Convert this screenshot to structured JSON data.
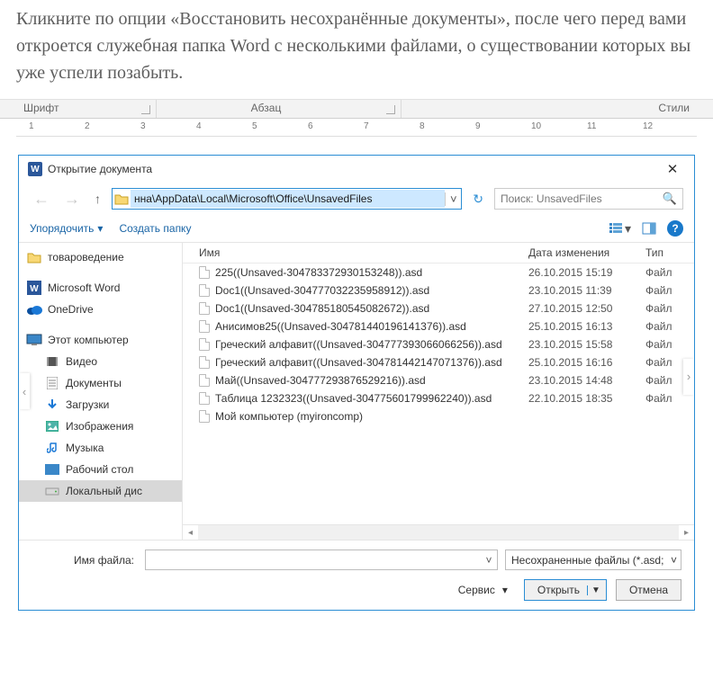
{
  "article": "Кликните по опции «Восстановить несохранённые документы», после чего перед вами откроется служебная папка Word с несколькими файлами, о существовании которых вы уже успели позабыть.",
  "ribbon": {
    "font": "Шрифт",
    "para": "Абзац",
    "styles": "Стили"
  },
  "ruler_ticks": [
    "1",
    "2",
    "3",
    "4",
    "5",
    "6",
    "7",
    "8",
    "9",
    "10",
    "11",
    "12"
  ],
  "dialog": {
    "title": "Открытие документа",
    "path": "нна\\AppData\\Local\\Microsoft\\Office\\UnsavedFiles",
    "search_placeholder": "Поиск: UnsavedFiles",
    "toolbar": {
      "organize": "Упорядочить",
      "newfolder": "Создать папку"
    },
    "columns": {
      "name": "Имя",
      "date": "Дата изменения",
      "type": "Тип"
    },
    "nav": [
      {
        "label": "товароведение",
        "icon": "folder"
      },
      {
        "label": "Microsoft Word",
        "icon": "word"
      },
      {
        "label": "OneDrive",
        "icon": "onedrive"
      },
      {
        "label": "Этот компьютер",
        "icon": "pc"
      },
      {
        "label": "Видео",
        "icon": "video",
        "indent": true
      },
      {
        "label": "Документы",
        "icon": "docs",
        "indent": true
      },
      {
        "label": "Загрузки",
        "icon": "down",
        "indent": true
      },
      {
        "label": "Изображения",
        "icon": "pic",
        "indent": true
      },
      {
        "label": "Музыка",
        "icon": "music",
        "indent": true
      },
      {
        "label": "Рабочий стол",
        "icon": "desk",
        "indent": true
      },
      {
        "label": "Локальный дис",
        "icon": "disk",
        "indent": true,
        "sel": true
      }
    ],
    "files": [
      {
        "name": "225((Unsaved-304783372930153248)).asd",
        "date": "26.10.2015 15:19",
        "type": "Файл"
      },
      {
        "name": "Doc1((Unsaved-304777032235958912)).asd",
        "date": "23.10.2015 11:39",
        "type": "Файл"
      },
      {
        "name": "Doc1((Unsaved-304785180545082672)).asd",
        "date": "27.10.2015 12:50",
        "type": "Файл"
      },
      {
        "name": "Анисимов25((Unsaved-304781440196141376)).asd",
        "date": "25.10.2015 16:13",
        "type": "Файл"
      },
      {
        "name": "Греческий алфавит((Unsaved-304777393066066256)).asd",
        "date": "23.10.2015 15:58",
        "type": "Файл"
      },
      {
        "name": "Греческий алфавит((Unsaved-304781442147071376)).asd",
        "date": "25.10.2015 16:16",
        "type": "Файл"
      },
      {
        "name": "Май((Unsaved-304777293876529216)).asd",
        "date": "23.10.2015 14:48",
        "type": "Файл"
      },
      {
        "name": "Таблица 1232323((Unsaved-304775601799962240)).asd",
        "date": "22.10.2015 18:35",
        "type": "Файл"
      },
      {
        "name": "Мой компьютер (myironcomp)",
        "date": "",
        "type": ""
      }
    ],
    "bottom": {
      "fname_label": "Имя файла:",
      "filter": "Несохраненные файлы (*.asd;",
      "service": "Сервис",
      "open": "Открыть",
      "cancel": "Отмена"
    }
  }
}
